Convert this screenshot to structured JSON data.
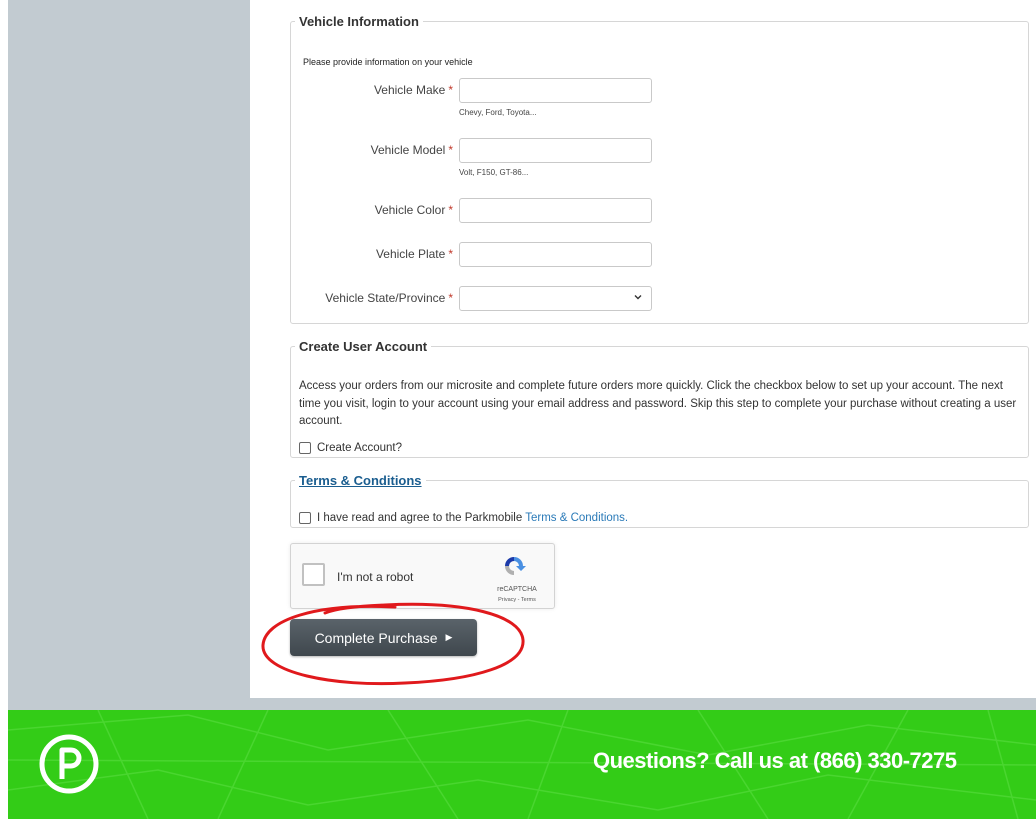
{
  "vehicle": {
    "legend": "Vehicle Information",
    "intro": "Please provide information on your vehicle",
    "required_mark": "*",
    "make": {
      "label": "Vehicle Make",
      "value": "",
      "hint": "Chevy, Ford, Toyota..."
    },
    "model": {
      "label": "Vehicle Model",
      "value": "",
      "hint": "Volt, F150, GT-86..."
    },
    "color": {
      "label": "Vehicle Color",
      "value": ""
    },
    "plate": {
      "label": "Vehicle Plate",
      "value": ""
    },
    "state": {
      "label": "Vehicle State/Province",
      "selected": ""
    }
  },
  "account": {
    "legend": "Create User Account",
    "description": "Access your orders from our microsite and complete future orders more quickly. Click the checkbox below to set up your account. The next time you visit, login to your account using your email address and password. Skip this step to complete your purchase without creating a user account.",
    "checkbox_label": "Create Account?"
  },
  "terms": {
    "legend": "Terms & Conditions",
    "agree_text": "I have read and agree to the Parkmobile",
    "link_text": "Terms & Conditions."
  },
  "captcha": {
    "label": "I'm not a robot",
    "brand": "reCAPTCHA",
    "privacy": "Privacy - Terms"
  },
  "purchase_button": {
    "label": "Complete Purchase",
    "arrow": "▶"
  },
  "footer": {
    "phone_text": "Questions? Call us at (866) 330-7275",
    "brand_color": "#33cc17"
  },
  "colors": {
    "sidebar": "#c2cbd1",
    "button": "#4a5258",
    "annotation": "#e0191c",
    "link": "#2a7ab8"
  }
}
